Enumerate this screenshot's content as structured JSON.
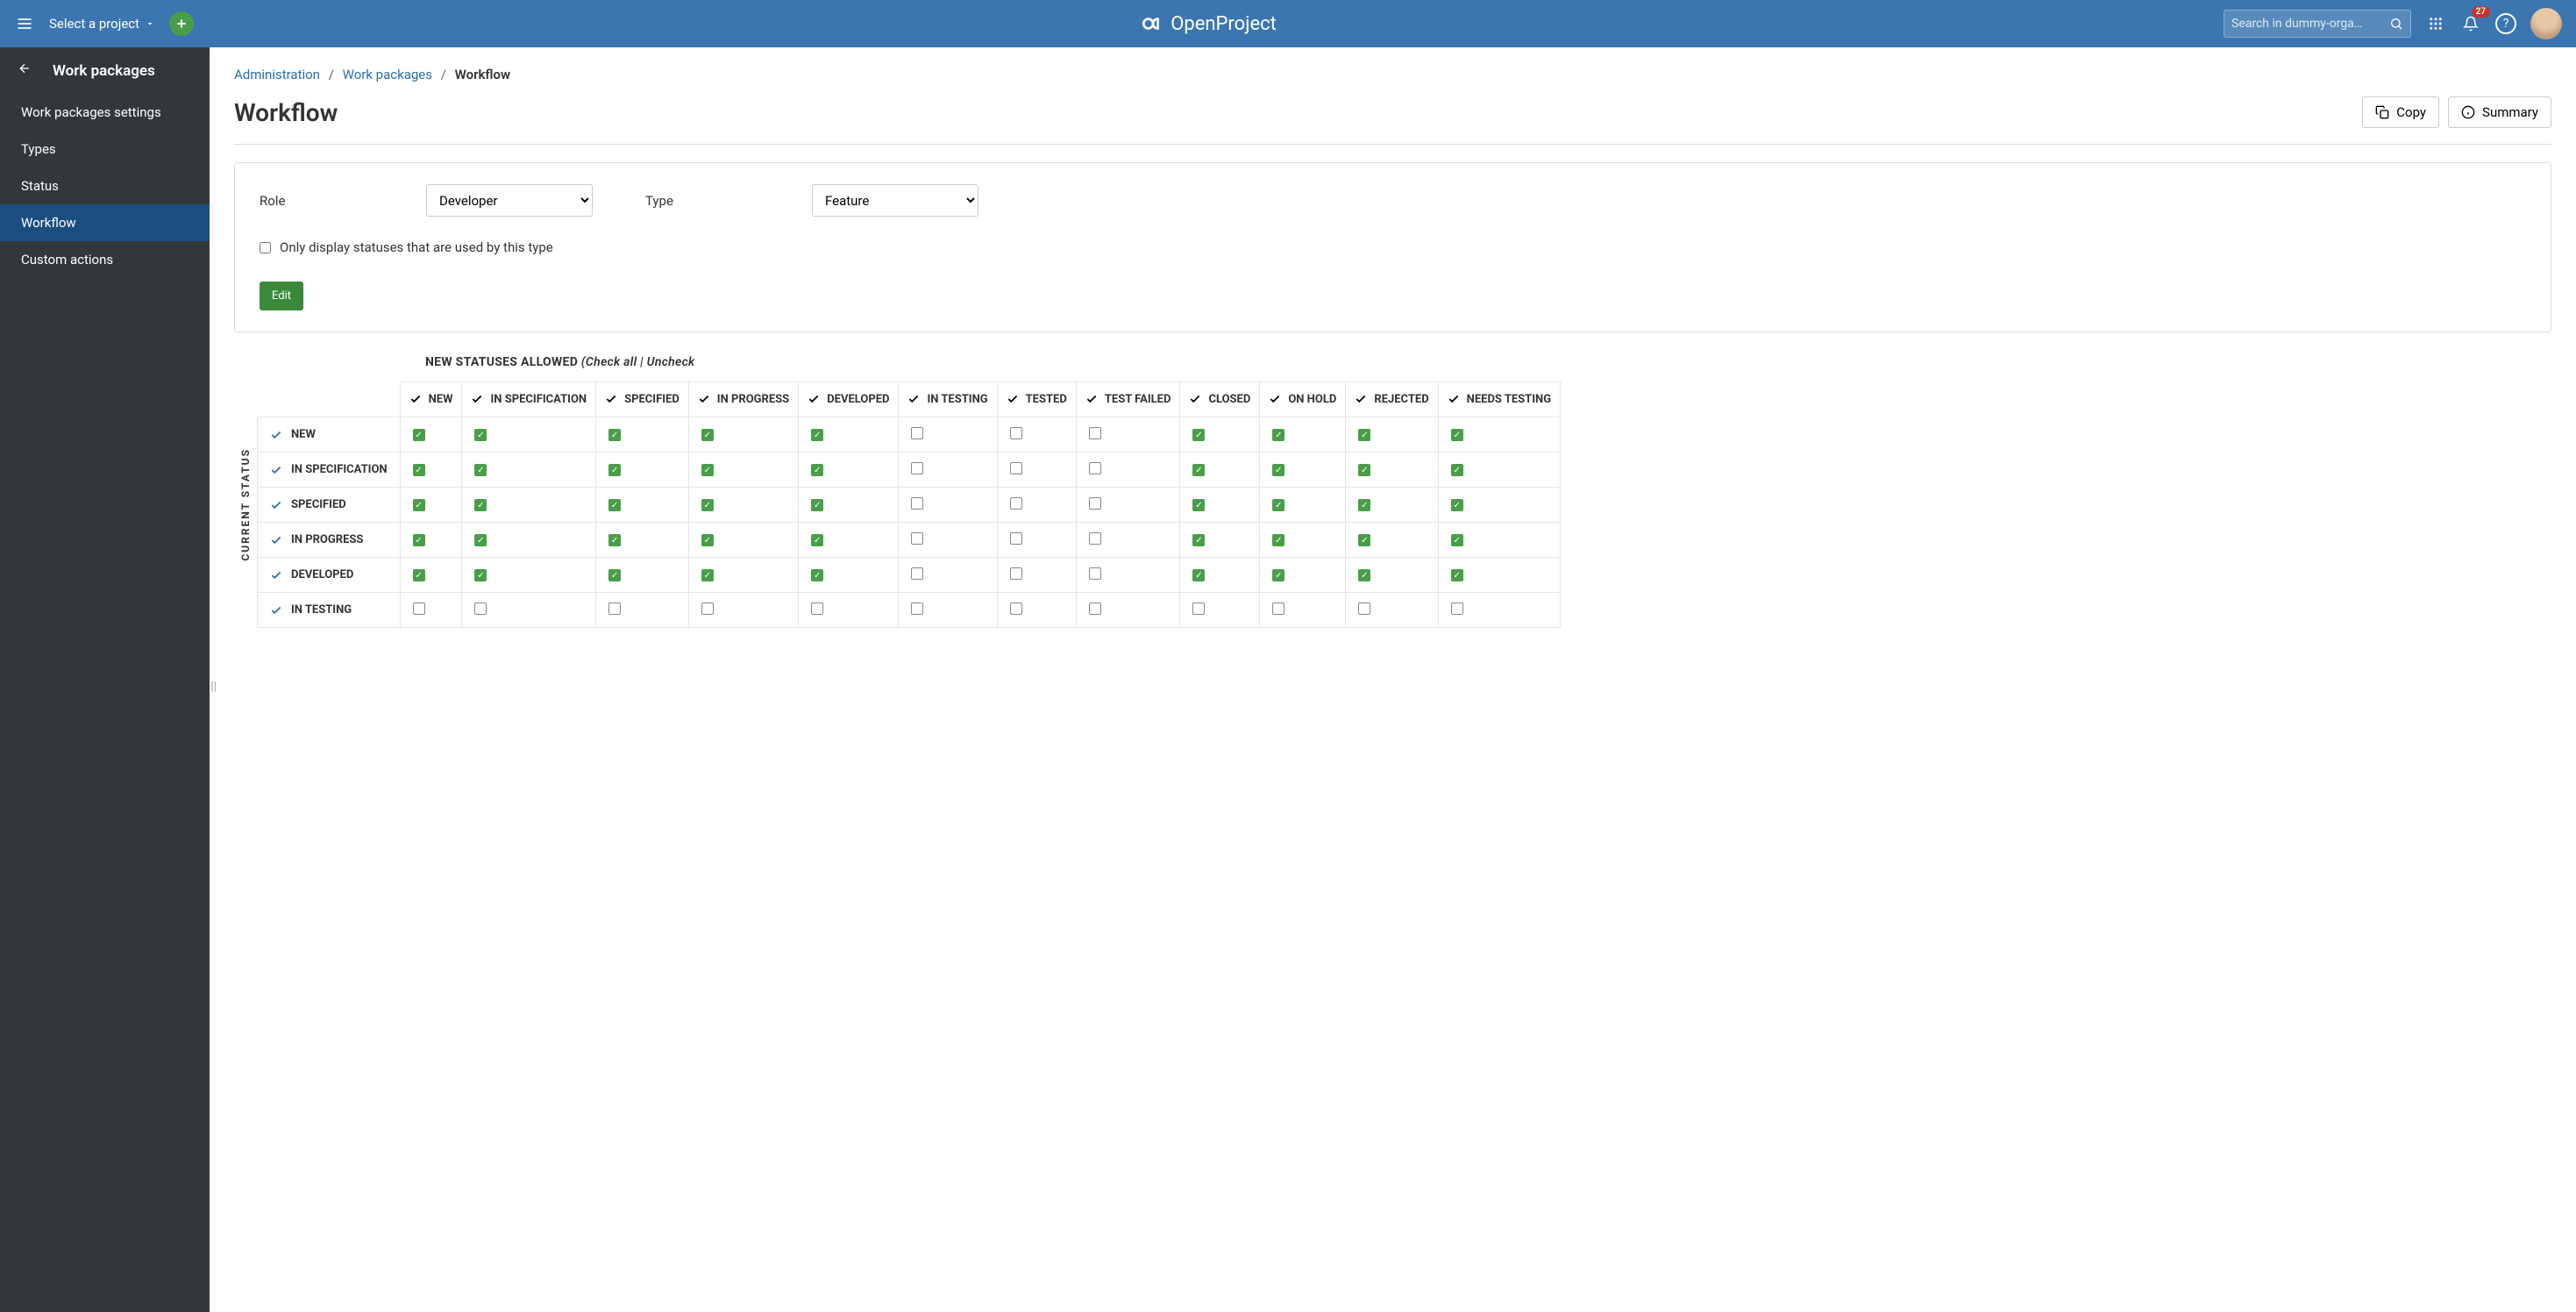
{
  "header": {
    "project_select": "Select a project",
    "search_placeholder": "Search in dummy-orga…",
    "notification_count": "27",
    "brand": "OpenProject"
  },
  "sidebar": {
    "title": "Work packages",
    "items": [
      "Work packages settings",
      "Types",
      "Status",
      "Workflow",
      "Custom actions"
    ],
    "active_index": 3
  },
  "breadcrumb": {
    "administration": "Administration",
    "wp": "Work packages",
    "current": "Workflow"
  },
  "page": {
    "title": "Workflow",
    "copy": "Copy",
    "summary": "Summary"
  },
  "filter": {
    "role_label": "Role",
    "role_value": "Developer",
    "type_label": "Type",
    "type_value": "Feature",
    "checkbox_label": "Only display statuses that are used by this type",
    "edit": "Edit"
  },
  "allowed": {
    "title": "NEW STATUSES ALLOWED",
    "sub": "(Check all | Uncheck",
    "vlabel": "CURRENT STATUS"
  },
  "columns": [
    "NEW",
    "IN SPECIFICATION",
    "SPECIFIED",
    "IN PROGRESS",
    "DEVELOPED",
    "IN TESTING",
    "TESTED",
    "TEST FAILED",
    "CLOSED",
    "ON HOLD",
    "REJECTED",
    "NEEDS TESTING"
  ],
  "rows": [
    {
      "label": "NEW",
      "cells": [
        1,
        1,
        1,
        1,
        1,
        0,
        0,
        0,
        1,
        1,
        1,
        1
      ]
    },
    {
      "label": "IN SPECIFICATION",
      "cells": [
        1,
        1,
        1,
        1,
        1,
        0,
        0,
        0,
        1,
        1,
        1,
        1
      ]
    },
    {
      "label": "SPECIFIED",
      "cells": [
        1,
        1,
        1,
        1,
        1,
        0,
        0,
        0,
        1,
        1,
        1,
        1
      ]
    },
    {
      "label": "IN PROGRESS",
      "cells": [
        1,
        1,
        1,
        1,
        1,
        0,
        0,
        0,
        1,
        1,
        1,
        1
      ]
    },
    {
      "label": "DEVELOPED",
      "cells": [
        1,
        1,
        1,
        1,
        1,
        0,
        0,
        0,
        1,
        1,
        1,
        1
      ]
    },
    {
      "label": "IN TESTING",
      "cells": [
        0,
        0,
        0,
        0,
        0,
        0,
        0,
        0,
        0,
        0,
        0,
        0
      ]
    }
  ]
}
